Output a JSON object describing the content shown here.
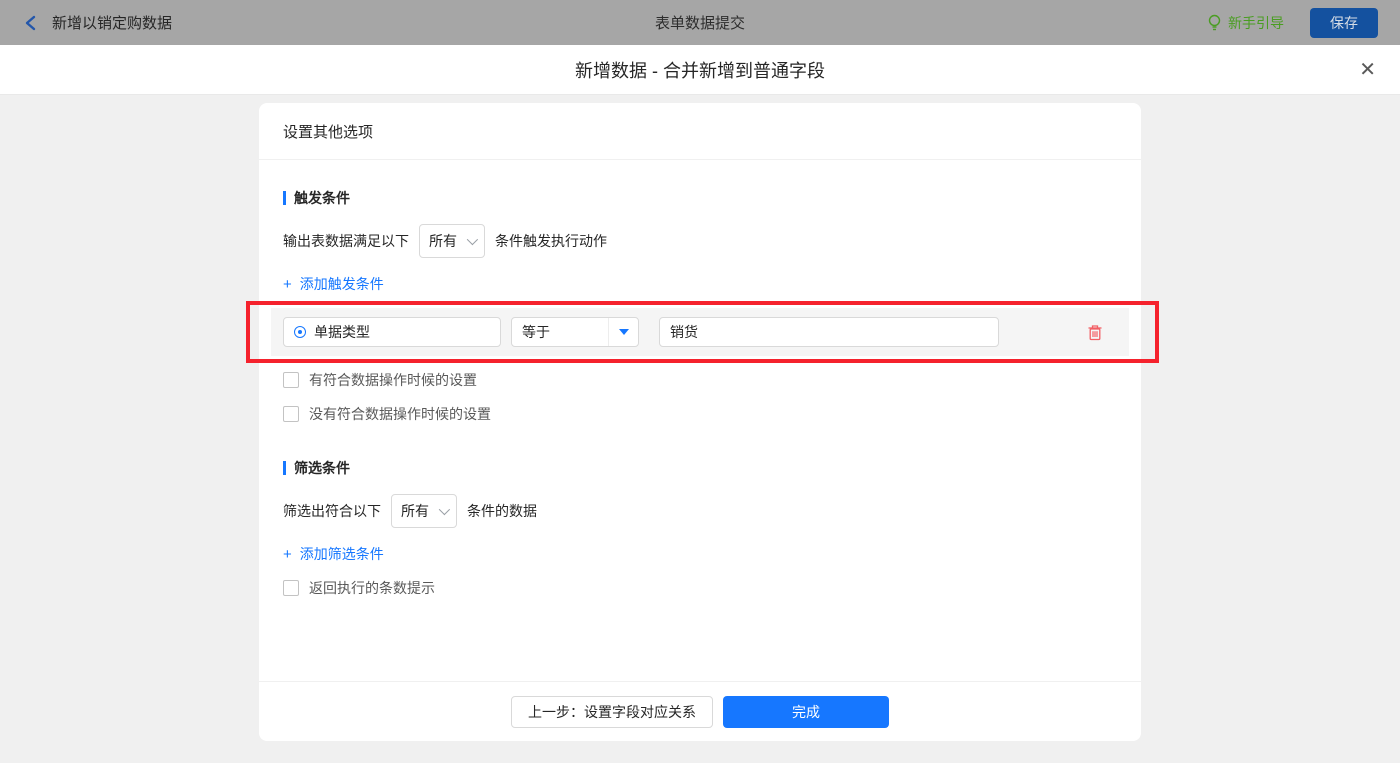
{
  "topbar": {
    "back_label": "新增以销定购数据",
    "center_title": "表单数据提交",
    "guide_label": "新手引导",
    "save_label": "保存"
  },
  "dialog": {
    "title": "新增数据 - 合并新增到普通字段",
    "close_icon": "✕"
  },
  "card": {
    "header": "设置其他选项",
    "trigger": {
      "section_title": "触发条件",
      "sentence_prefix": "输出表数据满足以下",
      "select_value": "所有",
      "sentence_suffix": "条件触发执行动作",
      "add_icon": "+",
      "add_label": "添加触发条件",
      "condition": {
        "field": "单据类型",
        "operator": "等于",
        "value": "销货"
      },
      "checkboxes": [
        "有符合数据操作时候的设置",
        "没有符合数据操作时候的设置"
      ]
    },
    "filter": {
      "section_title": "筛选条件",
      "sentence_prefix": "筛选出符合以下",
      "select_value": "所有",
      "sentence_suffix": "条件的数据",
      "add_icon": "+",
      "add_label": "添加筛选条件",
      "checkbox": "返回执行的条数提示"
    },
    "footer": {
      "prev_label": "上一步：设置字段对应关系",
      "done_label": "完成"
    }
  },
  "colors": {
    "accent_blue": "#1677ff",
    "annotation_red": "#f5222d",
    "guide_green": "#4a9d22",
    "topbar_gray": "#a6a6a6",
    "trash_red": "#f25f64"
  }
}
